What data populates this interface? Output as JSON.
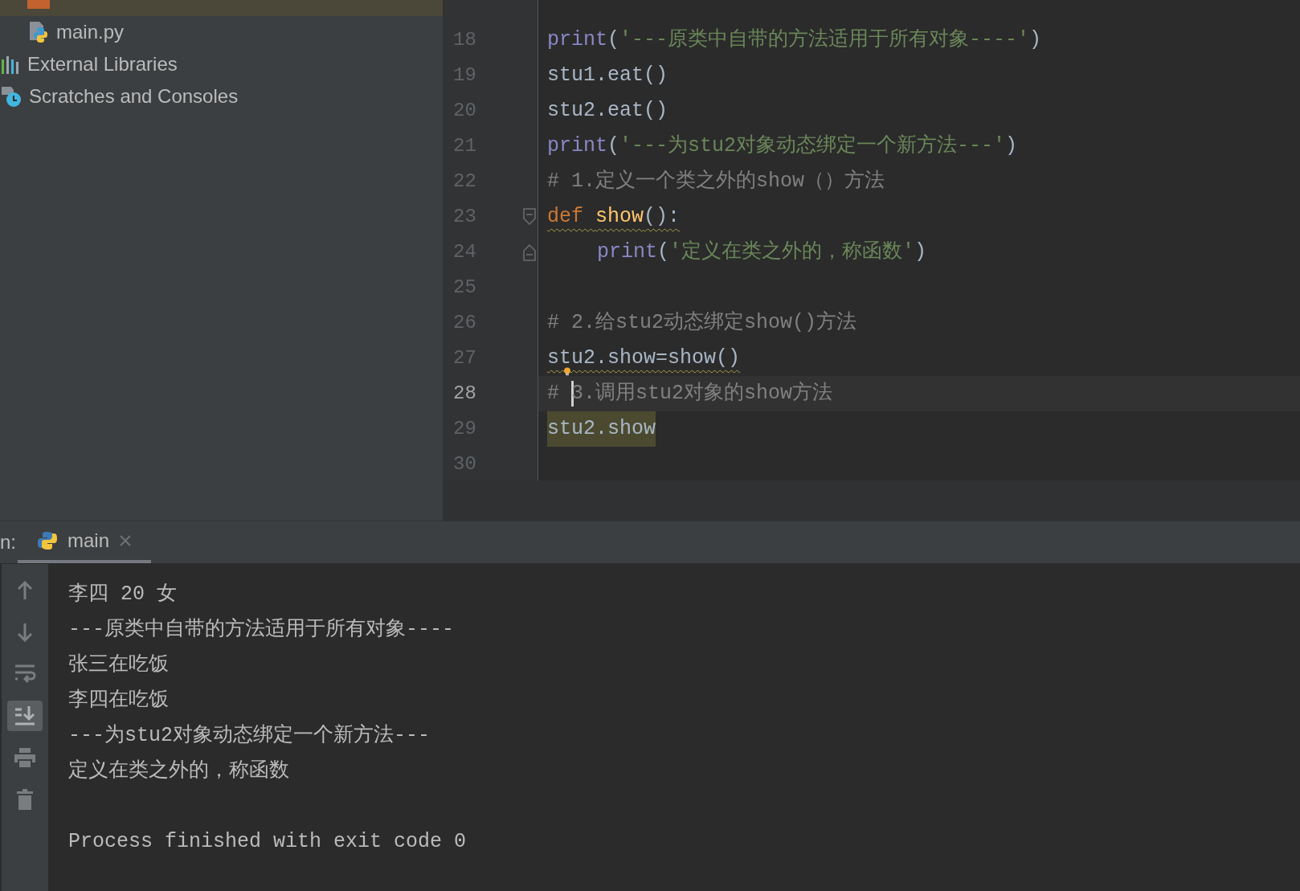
{
  "project_tree": [
    {
      "children": [
        {
          "kind": "folder",
          "selected": true
        },
        {
          "label": "main.py",
          "kind": "python",
          "selected": false
        }
      ]
    },
    {
      "label": "External Libraries",
      "kind": "libraries",
      "selected": false
    },
    {
      "label": "Scratches and Consoles",
      "kind": "scratches",
      "selected": false
    }
  ],
  "editor": {
    "lines": [
      {
        "number": "18",
        "current": false,
        "tokens": [
          {
            "kind": "builtin",
            "text": "print"
          },
          {
            "kind": "plain",
            "text": "("
          },
          {
            "kind": "string",
            "text": "'---原类中自带的方法适用于所有对象----'"
          },
          {
            "kind": "plain",
            "text": ")"
          }
        ]
      },
      {
        "number": "19",
        "current": false,
        "tokens": [
          {
            "kind": "plain",
            "text": "stu1.eat()"
          }
        ]
      },
      {
        "number": "20",
        "current": false,
        "tokens": [
          {
            "kind": "plain",
            "text": "stu2.eat()"
          }
        ]
      },
      {
        "number": "21",
        "current": false,
        "tokens": [
          {
            "kind": "builtin",
            "text": "print"
          },
          {
            "kind": "plain",
            "text": "("
          },
          {
            "kind": "string",
            "text": "'---为stu2对象动态绑定一个新方法---'"
          },
          {
            "kind": "plain",
            "text": ")"
          }
        ]
      },
      {
        "number": "22",
        "current": false,
        "tokens": [
          {
            "kind": "comment",
            "text": "# 1.定义一个类之外的show（）方法"
          }
        ]
      },
      {
        "number": "23",
        "current": false,
        "fold_open": true,
        "warning": true,
        "tokens": [
          {
            "kind": "keyword",
            "text": "def "
          },
          {
            "kind": "function",
            "text": "show"
          },
          {
            "kind": "plain",
            "text": "():"
          }
        ]
      },
      {
        "number": "24",
        "current": false,
        "fold_close": true,
        "indented": true,
        "tokens": [
          {
            "kind": "builtin",
            "text": "print"
          },
          {
            "kind": "plain",
            "text": "("
          },
          {
            "kind": "string",
            "text": "'定义在类之外的，称函数'"
          },
          {
            "kind": "plain",
            "text": ")"
          }
        ]
      },
      {
        "number": "25",
        "current": false
      },
      {
        "number": "26",
        "current": false,
        "tokens": [
          {
            "kind": "comment",
            "text": "# 2.给stu2动态绑定show()方法"
          }
        ]
      },
      {
        "number": "27",
        "current": false,
        "warning": true,
        "bulb": true,
        "tokens": [
          {
            "kind": "plain",
            "text": "stu2.show=show()"
          }
        ]
      },
      {
        "number": "28",
        "current": true,
        "caret": true,
        "tokens": [
          {
            "kind": "comment",
            "text": "# "
          },
          {
            "kind": "comment",
            "text": "3.调用stu2对象的show方法"
          }
        ]
      },
      {
        "number": "29",
        "current": false,
        "highlighted": true,
        "tokens": [
          {
            "kind": "plain",
            "text": "stu2.show"
          }
        ]
      },
      {
        "number": "30",
        "current": false
      }
    ]
  },
  "run_panel": {
    "label": "n:",
    "tabs": [
      {
        "label": "main",
        "selected": true
      }
    ],
    "toolbar": [
      {
        "kind": "up",
        "selected": false
      },
      {
        "kind": "down",
        "selected": false
      },
      {
        "kind": "wrap",
        "selected": false
      },
      {
        "kind": "scroll-end",
        "selected": true
      },
      {
        "kind": "print",
        "selected": false
      },
      {
        "kind": "trash",
        "selected": false
      }
    ],
    "output": [
      "李四 20 女",
      "---原类中自带的方法适用于所有对象----",
      "张三在吃饭",
      "李四在吃饭",
      "---为stu2对象动态绑定一个新方法---",
      "定义在类之外的，称函数"
    ],
    "exit_message": "Process finished with exit code 0"
  }
}
